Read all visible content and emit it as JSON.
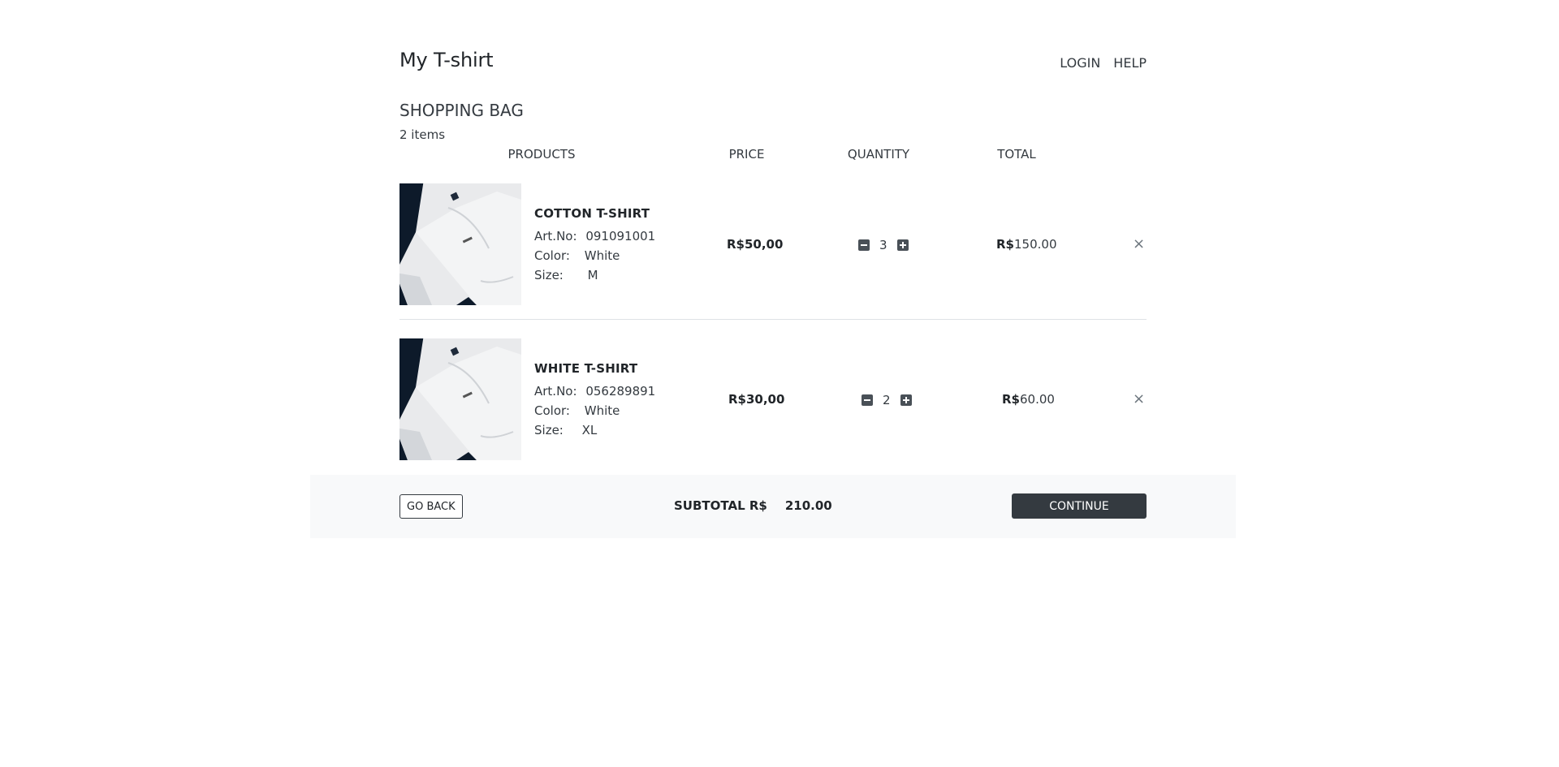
{
  "header": {
    "brand": "My T-shirt",
    "nav": {
      "login": "LOGIN",
      "help": "HELP"
    }
  },
  "bag": {
    "title": "SHOPPING BAG",
    "count": "2 items"
  },
  "columns": {
    "products": "PRODUCTS",
    "price": "PRICE",
    "quantity": "QUANTITY",
    "total": "TOTAL"
  },
  "labels": {
    "art_no": "Art.No:",
    "color": "Color:",
    "size": "Size:"
  },
  "items": [
    {
      "name": "COTTON T-SHIRT",
      "art_no": "091091001",
      "color": "White",
      "size": "M",
      "price": "R$50,00",
      "quantity": "3",
      "total_currency": "R$",
      "total_value": "150.00",
      "remove": "×"
    },
    {
      "name": "WHITE T-SHIRT",
      "art_no": "056289891",
      "color": "White",
      "size": "XL",
      "price": "R$30,00",
      "quantity": "2",
      "total_currency": "R$",
      "total_value": "60.00",
      "remove": "×"
    }
  ],
  "footer": {
    "go_back": "GO BACK",
    "subtotal_label": "SUBTOTAL R$",
    "subtotal_value": "210.00",
    "continue": "CONTINUE"
  },
  "icons": {
    "decrease": "minus-square-icon",
    "increase": "plus-square-icon",
    "remove": "close-icon"
  },
  "colors": {
    "text": "#212529",
    "dark_button": "#343a40",
    "footer_bg": "#f8f9fa"
  }
}
